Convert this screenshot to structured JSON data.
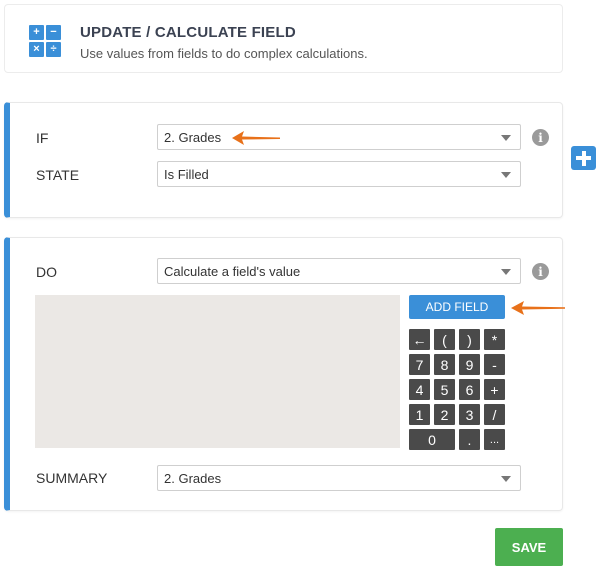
{
  "header": {
    "title": "UPDATE / CALCULATE FIELD",
    "subtitle": "Use values from fields to do complex calculations.",
    "icon_symbols": [
      "+",
      "−",
      "×",
      "÷"
    ]
  },
  "condition": {
    "if_label": "IF",
    "if_value": "2. Grades",
    "state_label": "STATE",
    "state_value": "Is Filled",
    "info_glyph": "i"
  },
  "action": {
    "do_label": "DO",
    "do_value": "Calculate a field's value",
    "add_field_label": "ADD FIELD",
    "summary_label": "SUMMARY",
    "summary_value": "2. Grades",
    "info_glyph": "i",
    "keypad": [
      [
        "←",
        "(",
        ")",
        "*"
      ],
      [
        "7",
        "8",
        "9",
        "-"
      ],
      [
        "4",
        "5",
        "6",
        "+"
      ],
      [
        "1",
        "2",
        "3",
        "/"
      ],
      [
        "0",
        ".",
        "..."
      ]
    ]
  },
  "save_label": "SAVE",
  "colors": {
    "accent": "#3a8fd8",
    "save": "#4caf50",
    "arrow": "#e8711a",
    "key": "#4a4a4a"
  }
}
